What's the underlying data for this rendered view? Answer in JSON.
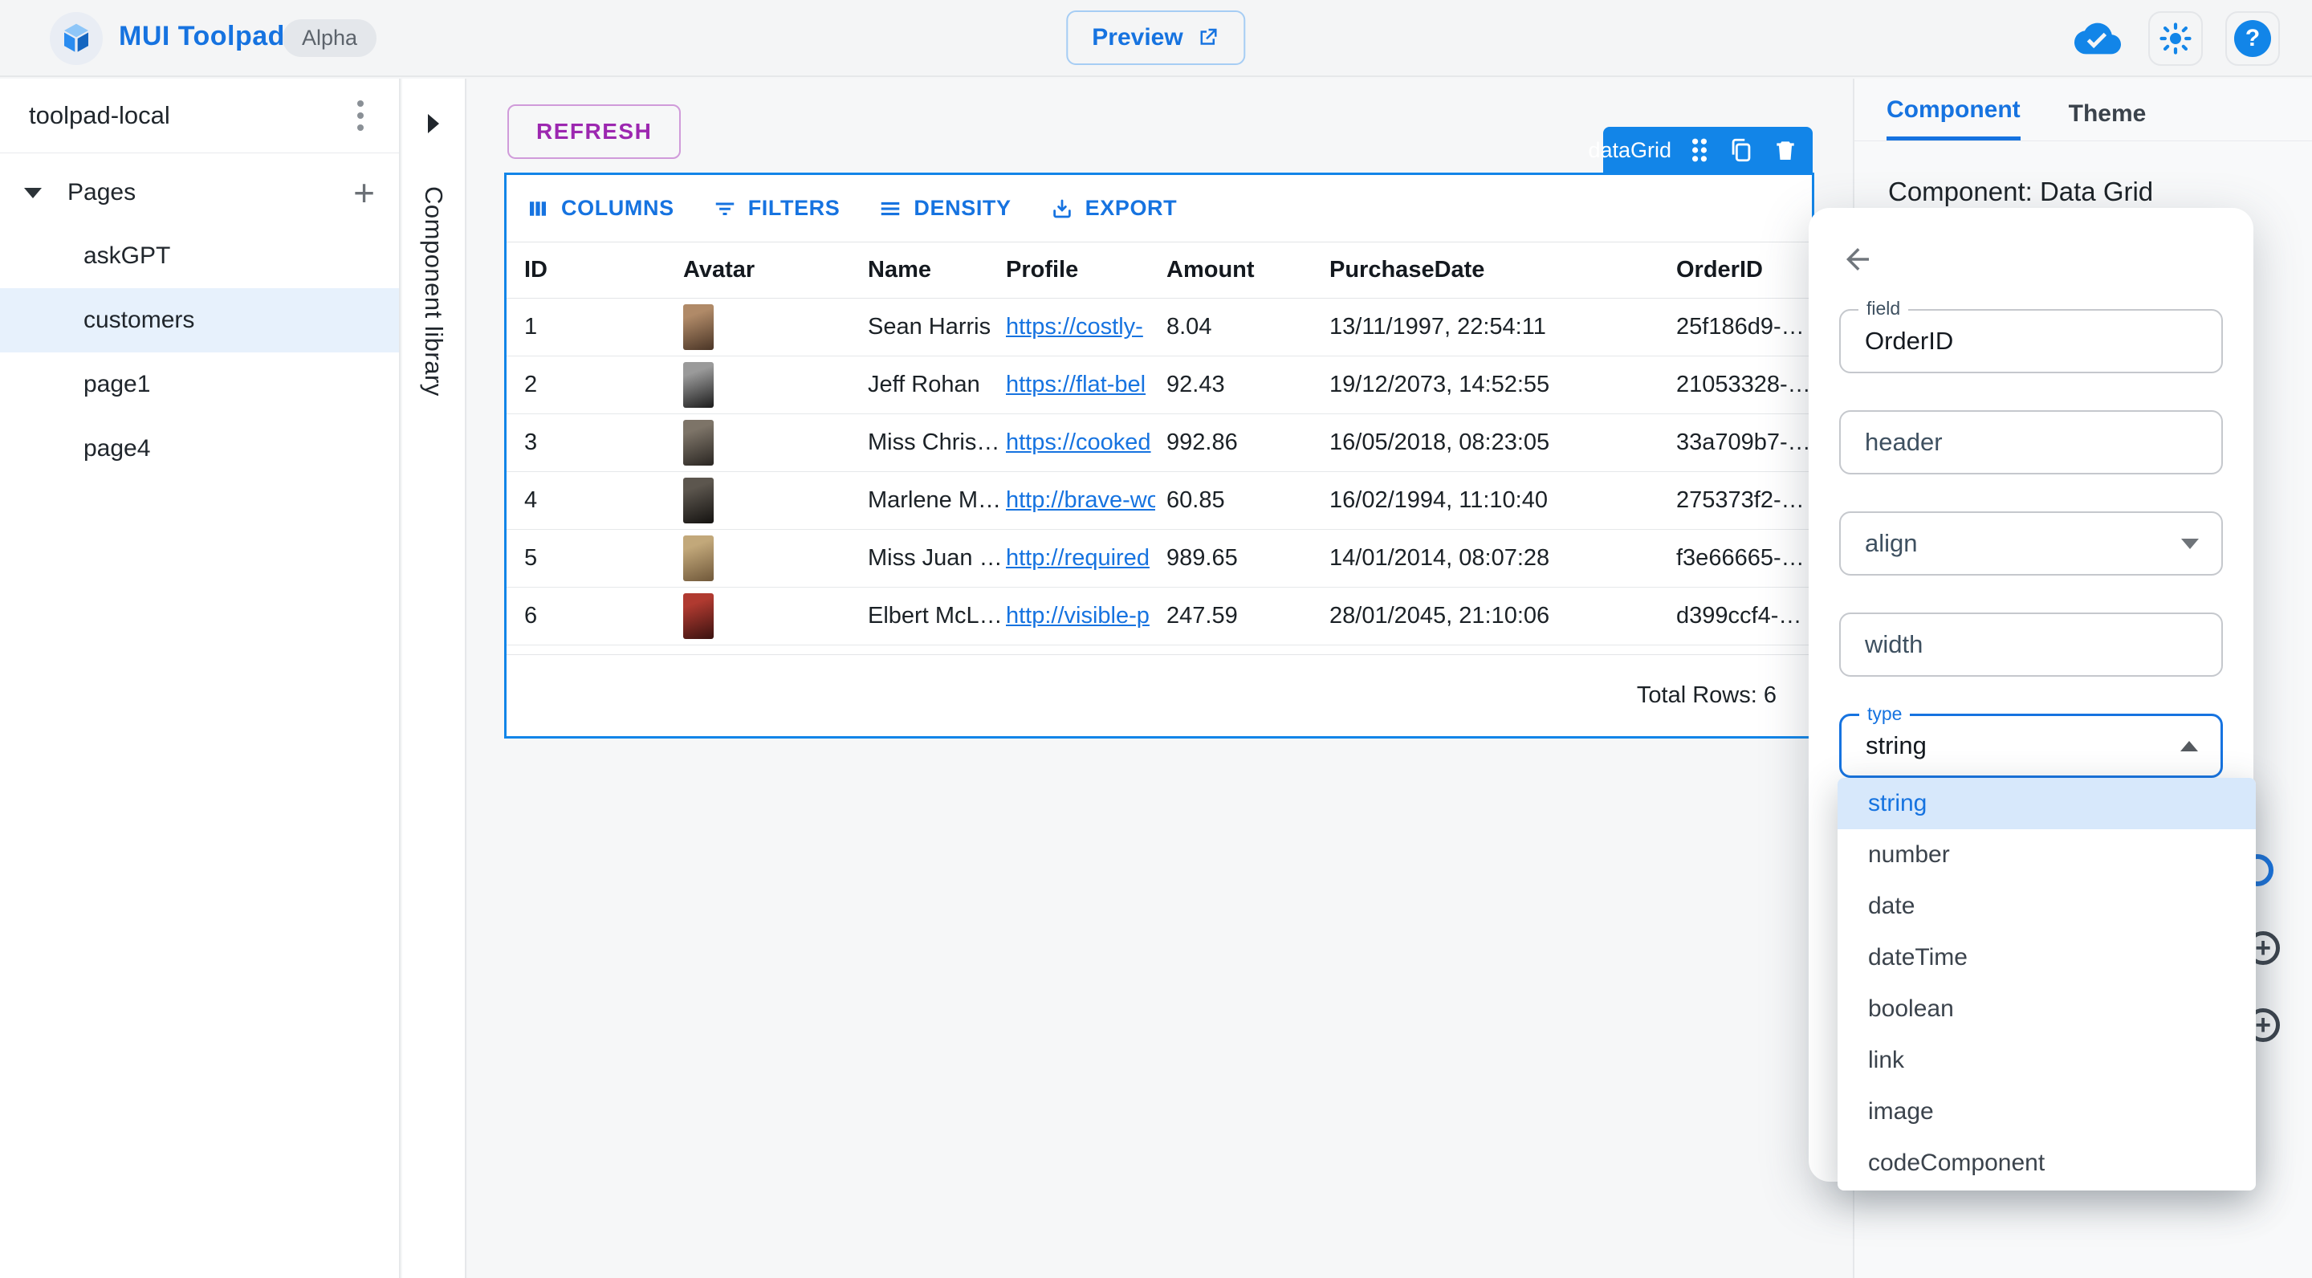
{
  "app_bar": {
    "title": "MUI Toolpad",
    "version_badge": "Alpha",
    "preview_button": "Preview",
    "help_glyph": "?"
  },
  "sidebar": {
    "project_name": "toolpad-local",
    "pages_section_label": "Pages",
    "pages": [
      {
        "label": "askGPT",
        "selected": false
      },
      {
        "label": "customers",
        "selected": true
      },
      {
        "label": "page1",
        "selected": false
      },
      {
        "label": "page4",
        "selected": false
      }
    ]
  },
  "component_library": {
    "label": "Component library"
  },
  "canvas": {
    "refresh_button": "REFRESH",
    "selection_chip": "dataGrid"
  },
  "data_grid": {
    "toolbar": [
      {
        "label": "COLUMNS",
        "icon": "view-columns-icon"
      },
      {
        "label": "FILTERS",
        "icon": "filter-list-icon"
      },
      {
        "label": "DENSITY",
        "icon": "density-icon"
      },
      {
        "label": "EXPORT",
        "icon": "download-icon"
      }
    ],
    "columns": [
      "ID",
      "Avatar",
      "Name",
      "Profile",
      "Amount",
      "PurchaseDate",
      "OrderID"
    ],
    "rows": [
      {
        "id": "1",
        "name": "Sean Harris",
        "profile": "https://costly-",
        "amount": "8.04",
        "purchase_date": "13/11/1997, 22:54:11",
        "order_id": "25f186d9-…",
        "avatar_colors": [
          "#b08a68",
          "#4a3526"
        ]
      },
      {
        "id": "2",
        "name": "Jeff Rohan",
        "profile": "https://flat-bel",
        "amount": "92.43",
        "purchase_date": "19/12/2073, 14:52:55",
        "order_id": "21053328-…",
        "avatar_colors": [
          "#9a9a9a",
          "#1c1c1c"
        ]
      },
      {
        "id": "3",
        "name": "Miss Chris…",
        "profile": "https://cooked",
        "amount": "992.86",
        "purchase_date": "16/05/2018, 08:23:05",
        "order_id": "33a709b7-…",
        "avatar_colors": [
          "#7d7468",
          "#2a2622"
        ]
      },
      {
        "id": "4",
        "name": "Marlene M…",
        "profile": "http://brave-wo",
        "amount": "60.85",
        "purchase_date": "16/02/1994, 11:10:40",
        "order_id": "275373f2-…",
        "avatar_colors": [
          "#5c564e",
          "#141210"
        ]
      },
      {
        "id": "5",
        "name": "Miss Juan …",
        "profile": "http://required",
        "amount": "989.65",
        "purchase_date": "14/01/2014, 08:07:28",
        "order_id": "f3e66665-…",
        "avatar_colors": [
          "#c2a87a",
          "#70583a"
        ]
      },
      {
        "id": "6",
        "name": "Elbert McL…",
        "profile": "http://visible-p",
        "amount": "247.59",
        "purchase_date": "28/01/2045, 21:10:06",
        "order_id": "d399ccf4-…",
        "avatar_colors": [
          "#b03a30",
          "#3a1210"
        ]
      }
    ],
    "footer": "Total Rows: 6"
  },
  "inspector": {
    "tabs": [
      {
        "label": "Component",
        "active": true
      },
      {
        "label": "Theme",
        "active": false
      }
    ],
    "heading": "Component: Data Grid",
    "column_editor": {
      "field_label": "field",
      "field_value": "OrderID",
      "header_placeholder": "header",
      "align_placeholder": "align",
      "width_placeholder": "width",
      "type_label": "type",
      "type_value": "string",
      "type_options": [
        {
          "label": "string",
          "selected": true
        },
        {
          "label": "number",
          "selected": false
        },
        {
          "label": "date",
          "selected": false
        },
        {
          "label": "dateTime",
          "selected": false
        },
        {
          "label": "boolean",
          "selected": false
        },
        {
          "label": "link",
          "selected": false
        },
        {
          "label": "image",
          "selected": false
        },
        {
          "label": "codeComponent",
          "selected": false
        }
      ]
    }
  },
  "colors": {
    "primary_blue": "#1673e0",
    "chip_blue": "#1285e8",
    "secondary_purple": "#9c27b0",
    "selected_item_bg": "#e7f1fc",
    "menu_selected_bg": "#d7e8fb"
  }
}
